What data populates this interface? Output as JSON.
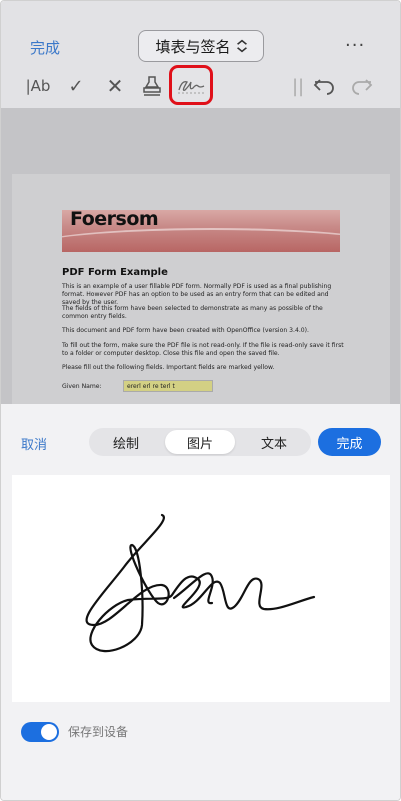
{
  "nav": {
    "done_label": "完成",
    "title": "填表与签名",
    "more_label": "···"
  },
  "toolbar": {
    "text_tool_label": "|Ab",
    "check_label": "✓",
    "cross_label": "✕",
    "separator": "||",
    "icons": [
      "text-icon",
      "checkmark-icon",
      "cross-icon",
      "stamp-icon",
      "signature-icon",
      "undo-icon",
      "redo-icon"
    ],
    "highlight_color": "#e0101a"
  },
  "document": {
    "brand": "Foersom",
    "heading": "PDF Form Example",
    "paragraphs": [
      "This is an example of a user fillable PDF form. Normally PDF is used as a final publishing format. However PDF has an option to be used as an entry form that can be edited and saved by the user.",
      "The fields of this form have been selected to demonstrate as many as possible of the common entry fields.",
      "This document and PDF form have been created with OpenOffice (version 3.4.0).",
      "To fill out the form, make sure the PDF file is not read-only. If the file is read-only save it first to a folder or computer desktop. Close this file and open the saved file.",
      "Please fill out the following fields. Important fields are marked yellow."
    ],
    "given_name_label": "Given Name:",
    "given_name_value": "ererl erl re terl t"
  },
  "signature_panel": {
    "cancel_label": "取消",
    "tabs": [
      "绘制",
      "图片",
      "文本"
    ],
    "active_tab": "图片",
    "done_label": "完成",
    "save_to_device_label": "保存到设备",
    "save_to_device": true,
    "accent_color": "#1c6fe0"
  }
}
